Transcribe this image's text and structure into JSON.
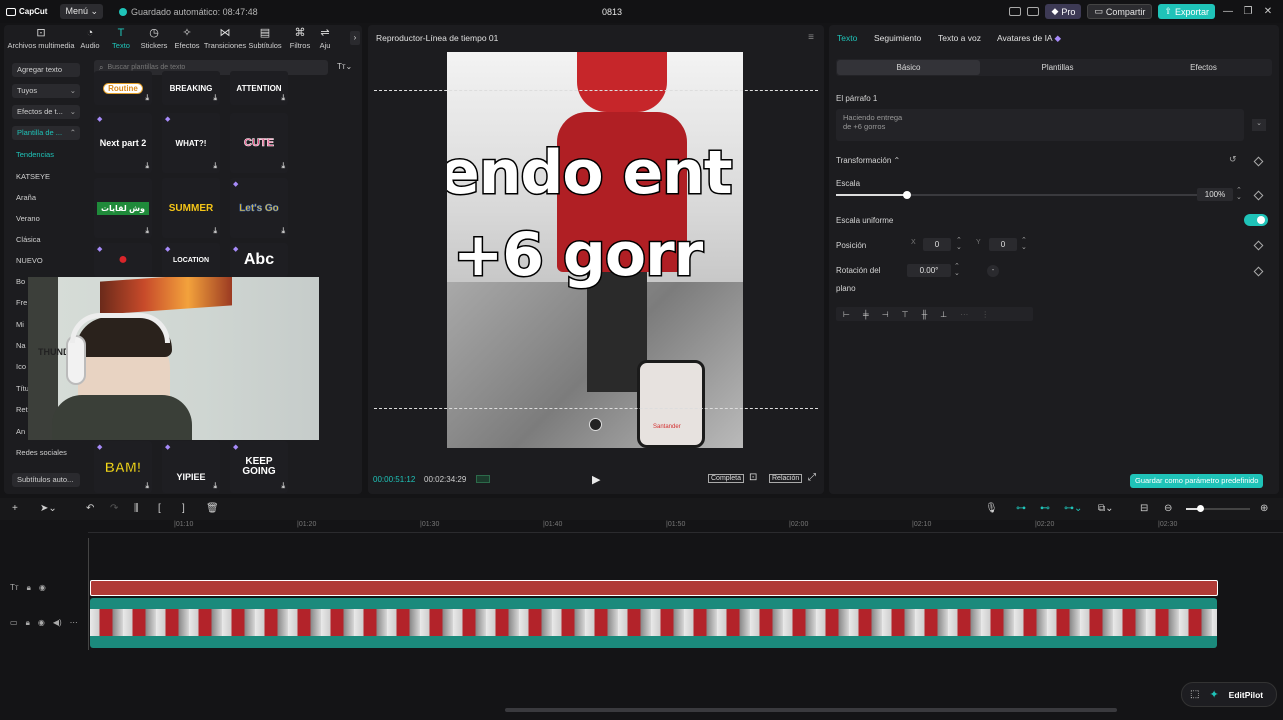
{
  "app": {
    "logo": "CapCut",
    "menu_label": "Menú",
    "autosave": "Guardado automático: 08:47:48",
    "project_title": "0813",
    "pro_label": "Pro",
    "share_label": "Compartir",
    "export_label": "Exportar"
  },
  "toolbar": [
    {
      "label": "Archivos multimedia",
      "icon": "media-icon"
    },
    {
      "label": "Audio",
      "icon": "audio-icon"
    },
    {
      "label": "Texto",
      "icon": "text-icon"
    },
    {
      "label": "Stickers",
      "icon": "sticker-icon"
    },
    {
      "label": "Efectos",
      "icon": "effects-icon"
    },
    {
      "label": "Transiciones",
      "icon": "transition-icon"
    },
    {
      "label": "Subtítulos",
      "icon": "subtitle-icon"
    },
    {
      "label": "Filtros",
      "icon": "filter-icon"
    },
    {
      "label": "Aju",
      "icon": "adjust-icon"
    }
  ],
  "sidebar": {
    "add_text": "Agregar texto",
    "yours": "Tuyos",
    "effects": "Efectos de t...",
    "templates": "Plantilla de ...",
    "items": [
      "Tendencias",
      "KATSEYE",
      "Araña",
      "Verano",
      "Clásica",
      "NUEVO",
      "Bo",
      "Fre",
      "Mi",
      "Na",
      "Ico",
      "Títu",
      "Ret",
      "An",
      "Redes sociales"
    ],
    "auto_subs": "Subtítulos auto..."
  },
  "search": {
    "placeholder": "Buscar plantillas de texto"
  },
  "templates": [
    {
      "text": "Routine"
    },
    {
      "text": "BREAKING"
    },
    {
      "text": "ATTENTION"
    },
    {
      "text": "Next part 2"
    },
    {
      "text": "WHAT?!"
    },
    {
      "text": "CUTE"
    },
    {
      "text": "وش لقايات"
    },
    {
      "text": "SUMMER"
    },
    {
      "text": "Let's Go"
    },
    {
      "text": "LOCATION"
    },
    {
      "text": "Abc"
    },
    {
      "text": "BAM!"
    },
    {
      "text": "YIPIEE"
    },
    {
      "text": "KEEP GOING"
    }
  ],
  "webcam": {
    "sign_text": "THUNDE"
  },
  "player": {
    "title": "Reproductor-Línea de tiempo 01",
    "caption_line1": "endo  ent",
    "caption_line2": "+6  gorr",
    "phone_text": "Santander",
    "time_current": "00:00:51:12",
    "time_total": "00:02:34:29",
    "full_label": "Completa",
    "ratio_label": "Relación"
  },
  "right_tabs": [
    "Texto",
    "Seguimiento",
    "Texto a voz",
    "Avatares de IA"
  ],
  "sub_tabs": [
    "Básico",
    "Plantillas",
    "Efectos"
  ],
  "props": {
    "paragraph_label": "El párrafo 1",
    "paragraph_text_line1": "Haciendo entrega",
    "paragraph_text_line2": "de +6 gorros",
    "transform_label": "Transformación",
    "scale_label": "Escala",
    "scale_value": "100%",
    "scale_fraction": 1.0,
    "uniform_label": "Escala uniforme",
    "position_label": "Posición",
    "x_label": "X",
    "x_value": "0",
    "y_label": "Y",
    "y_value": "0",
    "rotation_label": "Rotación del",
    "plane_label": "plano",
    "rotation_value": "0.00°",
    "save_preset": "Guardar como parámetro predefinido"
  },
  "ruler": [
    "|01:10",
    "|01:20",
    "|01:30",
    "|01:40",
    "|01:50",
    "|02:00",
    "|02:10",
    "|02:20",
    "|02:30"
  ],
  "bottom": {
    "editpilot": "EditPilot"
  },
  "colors": {
    "accent": "#1fc3b8",
    "text_clip": "#b03a36",
    "video_strip": "#1b8a7c"
  }
}
